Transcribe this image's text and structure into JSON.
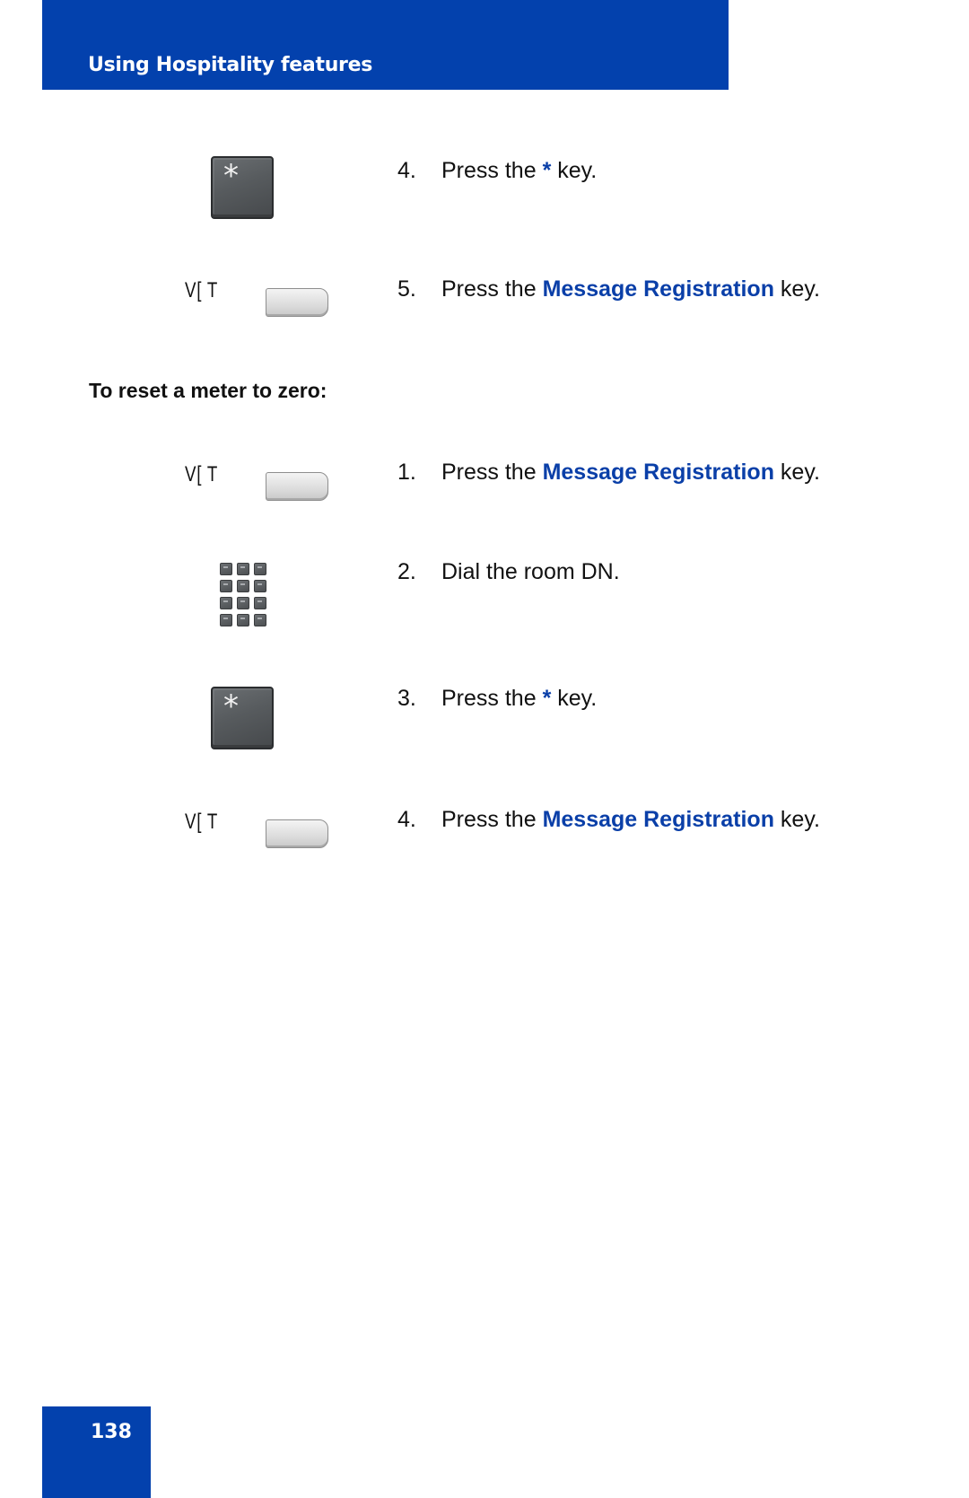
{
  "header": {
    "title": "Using Hospitality features",
    "color": "#0341ad"
  },
  "continued_steps": [
    {
      "icon": "star-key-icon",
      "number": "4.",
      "prefix": "Press the ",
      "highlight": "*",
      "suffix": " key."
    },
    {
      "icon": "softkey-icon",
      "softkey_label": "V[ T",
      "number": "5.",
      "prefix": "Press the ",
      "highlight": "Message Registration",
      "suffix": " key."
    }
  ],
  "section": {
    "heading": "To reset a meter to zero:",
    "steps": [
      {
        "icon": "softkey-icon",
        "softkey_label": "V[ T",
        "number": "1.",
        "prefix": "Press the ",
        "highlight": "Message Registration",
        "suffix": " key."
      },
      {
        "icon": "dialpad-icon",
        "number": "2.",
        "text": "Dial the room DN."
      },
      {
        "icon": "star-key-icon",
        "number": "3.",
        "prefix": "Press the ",
        "highlight": "*",
        "suffix": " key."
      },
      {
        "icon": "softkey-icon",
        "softkey_label": "V[ T",
        "number": "4.",
        "prefix": "Press the ",
        "highlight": "Message Registration",
        "suffix": " key."
      }
    ]
  },
  "star_key_glyph": "*",
  "highlight_color": "#0a3fa8",
  "page_number": "138"
}
